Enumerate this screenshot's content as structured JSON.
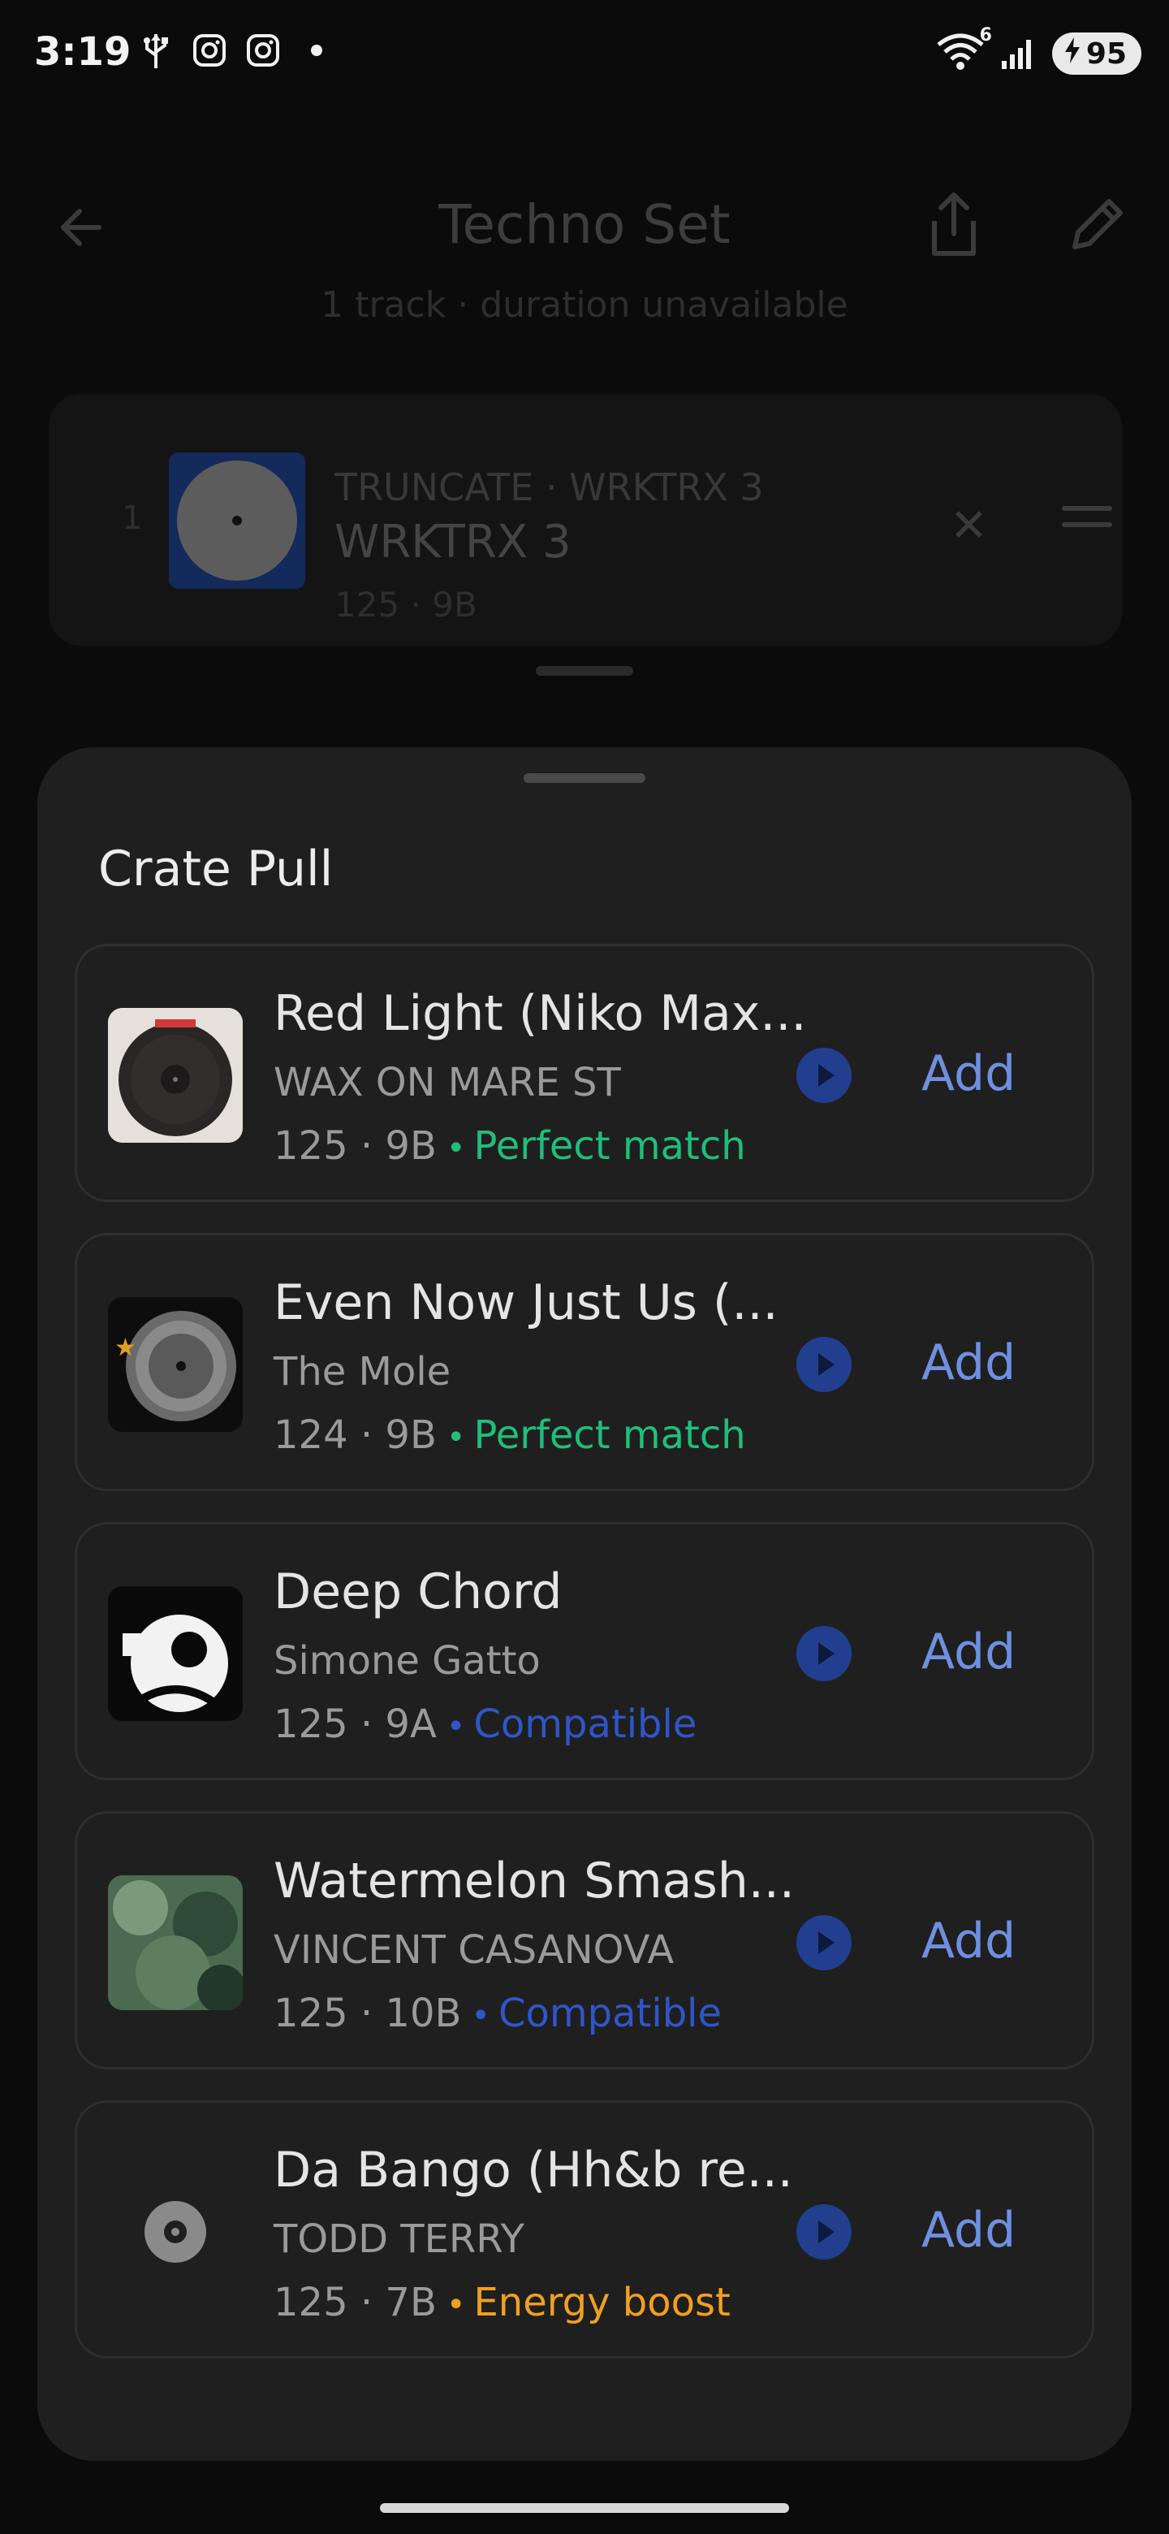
{
  "status_bar": {
    "time": "3:19",
    "signal_badge": "6",
    "battery": "95"
  },
  "playlist": {
    "title": "Techno Set",
    "subtitle": "1 track · duration unavailable",
    "track": {
      "number": "1",
      "artist_line": "TRUNCATE · WRKTRX 3",
      "title": "WRKTRX 3",
      "meta": "125 · 9B"
    }
  },
  "sheet": {
    "title": "Crate Pull",
    "add_label": "Add",
    "items": [
      {
        "title": "Red Light (Niko Max...",
        "artist": "WAX ON MARE ST",
        "bpm": "125",
        "key": "9B",
        "tag": "Perfect match",
        "tag_color": "#1fbf7a",
        "art": "red-light-art"
      },
      {
        "title": "Even Now Just Us (...",
        "artist": "The Mole",
        "bpm": "124",
        "key": "9B",
        "tag": "Perfect match",
        "tag_color": "#1fbf7a",
        "art": "vinyl-black-art"
      },
      {
        "title": "Deep Chord",
        "artist": "Simone Gatto",
        "bpm": "125",
        "key": "9A",
        "tag": "Compatible",
        "tag_color": "#2f55c9",
        "art": "deep-vibes-art"
      },
      {
        "title": "Watermelon Smash...",
        "artist": "VINCENT CASANOVA",
        "bpm": "125",
        "key": "10B",
        "tag": "Compatible",
        "tag_color": "#2f55c9",
        "art": "forest-art"
      },
      {
        "title": "Da Bango (Hh&b re...",
        "artist": "TODD TERRY",
        "bpm": "125",
        "key": "7B",
        "tag": "Energy boost",
        "tag_color": "#f0a020",
        "art": "disc-placeholder-icon"
      }
    ]
  }
}
